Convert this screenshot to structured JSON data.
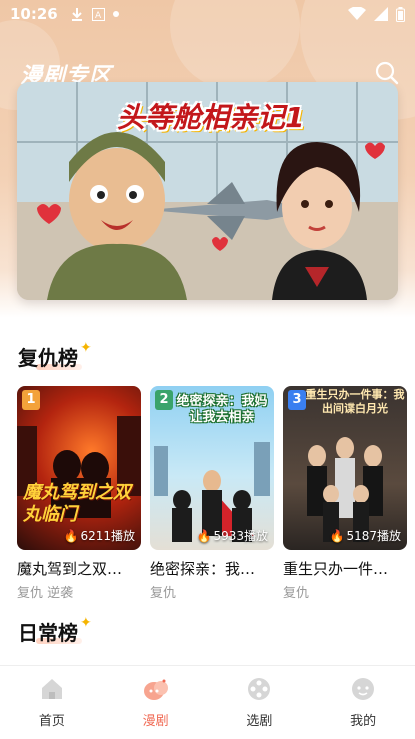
{
  "status_bar": {
    "time": "10:26",
    "left_icons": [
      "download-icon",
      "text-a-icon",
      "dot-icon"
    ],
    "right_icons": [
      "wifi-icon",
      "signal-icon",
      "battery-icon"
    ]
  },
  "header": {
    "title": "漫剧专区",
    "search_icon": "search-icon"
  },
  "banner": {
    "title": "头等舱相亲记1"
  },
  "sections": [
    {
      "title": "复仇榜",
      "items": [
        {
          "rank": "1",
          "title": "魔丸驾到之双…",
          "cover_text": "魔丸驾到之双丸临门",
          "plays": "6211播放",
          "tags": "复仇 逆袭",
          "badge_color": "#f3a23a"
        },
        {
          "rank": "2",
          "title": "绝密探亲：我…",
          "cover_text": "绝密探亲：我妈让我去相亲",
          "plays": "5933播放",
          "tags": "复仇",
          "badge_color": "#3aa36b"
        },
        {
          "rank": "3",
          "title": "重生只办一件…",
          "cover_text": "重生只办一件事：我出间谍白月光",
          "plays": "5187播放",
          "tags": "复仇",
          "badge_color": "#3a7ff0"
        }
      ]
    },
    {
      "title": "日常榜"
    }
  ],
  "bottom_nav": [
    {
      "label": "首页",
      "icon": "home-icon",
      "active": false
    },
    {
      "label": "漫剧",
      "icon": "manju-icon",
      "active": true
    },
    {
      "label": "选剧",
      "icon": "film-reel-icon",
      "active": false
    },
    {
      "label": "我的",
      "icon": "profile-icon",
      "active": false
    }
  ],
  "colors": {
    "accent": "#f06a54",
    "header_bg": "#efc7a6",
    "sparkle": "#f5b400"
  }
}
